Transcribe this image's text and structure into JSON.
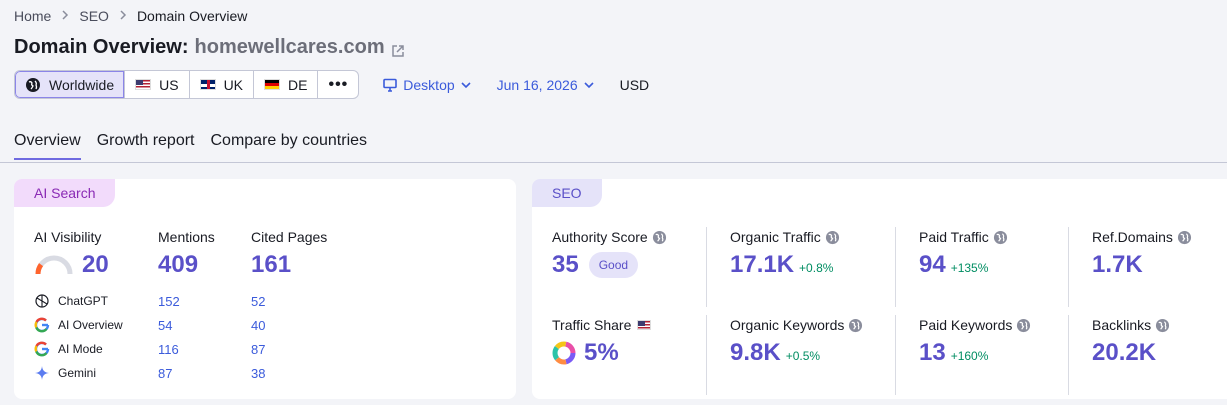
{
  "breadcrumb": {
    "items": [
      "Home",
      "SEO",
      "Domain Overview"
    ]
  },
  "page": {
    "title_prefix": "Domain Overview:",
    "domain": "homewellcares.com"
  },
  "databases": [
    {
      "label": "Worldwide",
      "icon": "globe-icon",
      "active": true
    },
    {
      "label": "US",
      "icon": "us-flag-icon"
    },
    {
      "label": "UK",
      "icon": "uk-flag-icon"
    },
    {
      "label": "DE",
      "icon": "de-flag-icon"
    },
    {
      "label": "•••",
      "icon": "more-icon"
    }
  ],
  "device": {
    "label": "Desktop",
    "icon": "monitor-icon"
  },
  "date": {
    "label": "Jun 16, 2026"
  },
  "currency": "USD",
  "tabs": [
    {
      "label": "Overview",
      "active": true
    },
    {
      "label": "Growth report"
    },
    {
      "label": "Compare by countries"
    }
  ],
  "ai_search": {
    "tag": "AI Search",
    "visibility": {
      "label": "AI Visibility",
      "value": "20",
      "gauge_fraction": 0.2
    },
    "mentions": {
      "label": "Mentions",
      "value": "409"
    },
    "cited": {
      "label": "Cited Pages",
      "value": "161"
    },
    "rows": [
      {
        "name": "ChatGPT",
        "icon": "chatgpt-icon",
        "mentions": "152",
        "cited": "52"
      },
      {
        "name": "AI Overview",
        "icon": "google-icon",
        "mentions": "54",
        "cited": "40"
      },
      {
        "name": "AI Mode",
        "icon": "google-icon",
        "mentions": "116",
        "cited": "87"
      },
      {
        "name": "Gemini",
        "icon": "gemini-icon",
        "mentions": "87",
        "cited": "38"
      }
    ]
  },
  "seo": {
    "tag": "SEO",
    "authority": {
      "label": "Authority Score",
      "value": "35",
      "badge": "Good"
    },
    "organic_traffic": {
      "label": "Organic Traffic",
      "value": "17.1K",
      "delta": "+0.8%"
    },
    "paid_traffic": {
      "label": "Paid Traffic",
      "value": "94",
      "delta": "+135%"
    },
    "ref_domains": {
      "label": "Ref.Domains",
      "value": "1.7K"
    },
    "traffic_share": {
      "label": "Traffic Share",
      "value": "5%",
      "fraction": 0.05
    },
    "organic_keywords": {
      "label": "Organic Keywords",
      "value": "9.8K",
      "delta": "+0.5%"
    },
    "paid_keywords": {
      "label": "Paid Keywords",
      "value": "13",
      "delta": "+160%"
    },
    "backlinks": {
      "label": "Backlinks",
      "value": "20.2K"
    }
  },
  "colors": {
    "accent": "#5a50c8",
    "link": "#3b5bdb",
    "positive": "#008d62",
    "ai_tag_bg": "#f2dbfb",
    "seo_tag_bg": "#e5e3f9"
  }
}
